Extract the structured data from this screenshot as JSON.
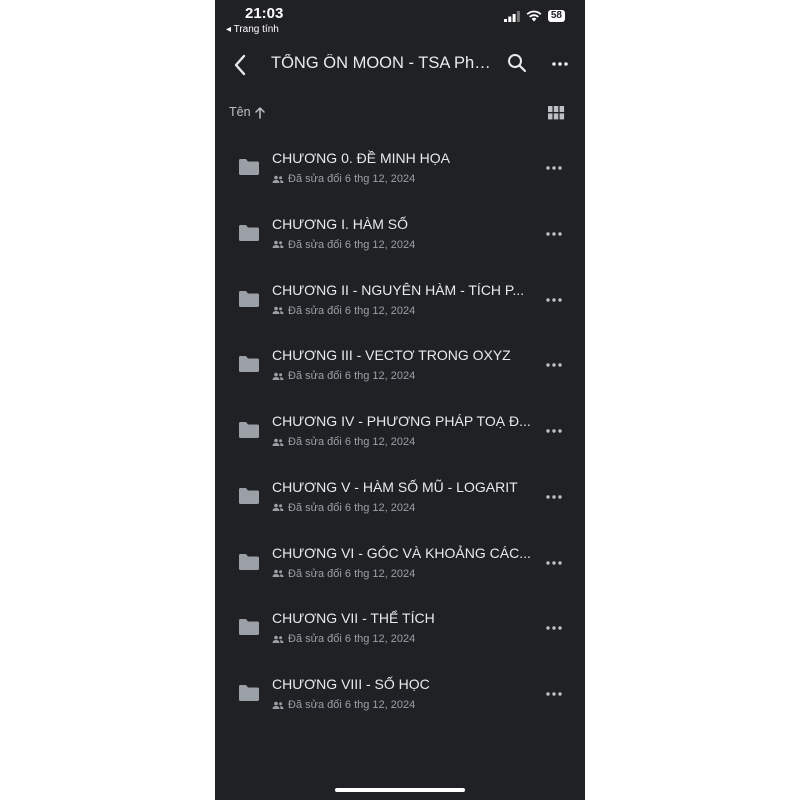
{
  "status_bar": {
    "time": "21:03",
    "back_app": "◂ Trang tính",
    "battery": "58"
  },
  "header": {
    "title": "TỔNG ÔN MOON - TSA Phầ..."
  },
  "sort": {
    "label": "Tên",
    "direction_icon": "arrow-up-icon"
  },
  "items": [
    {
      "name": "CHƯƠNG 0. ĐỀ MINH HỌA",
      "modified": "Đã sửa đổi 6 thg 12, 2024"
    },
    {
      "name": "CHƯƠNG I. HÀM SỐ",
      "modified": "Đã sửa đổi 6 thg 12, 2024"
    },
    {
      "name": "CHƯƠNG II - NGUYÊN HÀM - TÍCH P...",
      "modified": "Đã sửa đổi 6 thg 12, 2024"
    },
    {
      "name": "CHƯƠNG III - VECTƠ TRONG OXYZ",
      "modified": "Đã sửa đổi 6 thg 12, 2024"
    },
    {
      "name": "CHƯƠNG IV - PHƯƠNG PHÁP TOẠ Đ...",
      "modified": "Đã sửa đổi 6 thg 12, 2024"
    },
    {
      "name": "CHƯƠNG V - HÀM SỐ MŨ - LOGARIT",
      "modified": "Đã sửa đổi 6 thg 12, 2024"
    },
    {
      "name": "CHƯƠNG VI - GÓC VÀ KHOẢNG CÁC...",
      "modified": "Đã sửa đổi 6 thg 12, 2024"
    },
    {
      "name": "CHƯƠNG VII - THỂ TÍCH",
      "modified": "Đã sửa đổi 6 thg 12, 2024"
    },
    {
      "name": "CHƯƠNG VIII - SỐ HỌC",
      "modified": "Đã sửa đổi 6 thg 12, 2024"
    }
  ],
  "colors": {
    "background": "#202124",
    "text_primary": "#e8eaed",
    "text_secondary": "#9aa0a6",
    "folder": "#9aa0a6"
  }
}
